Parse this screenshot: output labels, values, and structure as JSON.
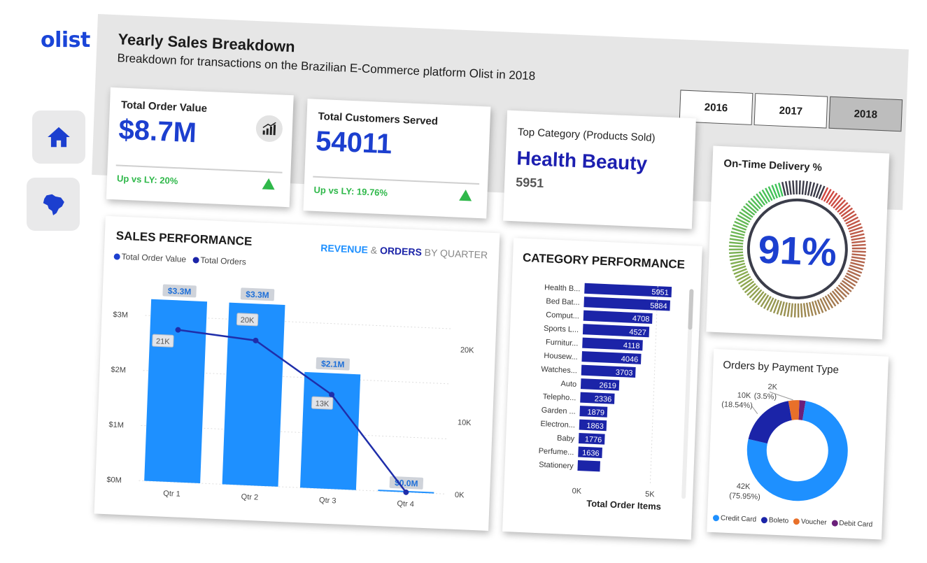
{
  "brand": {
    "logo": "olist"
  },
  "nav": {
    "home_icon": "home-icon",
    "map_icon": "brazil-map-icon"
  },
  "header": {
    "title": "Yearly Sales Breakdown",
    "subtitle": "Breakdown for transactions on the Brazilian E-Commerce platform Olist in 2018"
  },
  "years": {
    "options": [
      "2016",
      "2017",
      "2018"
    ],
    "selected": "2018"
  },
  "kpis": {
    "order_value": {
      "label": "Total Order Value",
      "value": "$8.7M",
      "trend": "Up vs LY: 20%"
    },
    "customers": {
      "label": "Total Customers Served",
      "value": "54011",
      "trend": "Up vs LY: 19.76%"
    },
    "top_category": {
      "label": "Top Category (Products Sold)",
      "value": "Health Beauty",
      "count": "5951"
    },
    "on_time": {
      "label": "On-Time Delivery %",
      "value": "91%"
    }
  },
  "sales_performance": {
    "title": "SALES PERFORMANCE",
    "subtitle_revenue": "REVENUE",
    "subtitle_amp": " & ",
    "subtitle_orders": "ORDERS",
    "subtitle_rest": " BY QUARTER",
    "legend_value": "Total Order Value",
    "legend_orders": "Total Orders",
    "colors": {
      "bar": "#1e90ff",
      "line": "#1f2eaa"
    }
  },
  "category_performance": {
    "title": "CATEGORY PERFORMANCE",
    "xlabel": "Total Order Items",
    "color": "#1b24a8"
  },
  "payment": {
    "title": "Orders by Payment Type",
    "legend": [
      "Credit Card",
      "Boleto",
      "Voucher",
      "Debit Card"
    ],
    "labels": {
      "credit": "42K",
      "credit_pct": "(75.95%)",
      "boleto": "10K",
      "boleto_pct": "(18.54%)",
      "voucher": "(3.5%)",
      "debit": "2K"
    }
  },
  "chart_data": [
    {
      "type": "bar",
      "title": "SALES PERFORMANCE",
      "categories": [
        "Qtr 1",
        "Qtr 2",
        "Qtr 3",
        "Qtr 4"
      ],
      "series": [
        {
          "name": "Total Order Value",
          "type": "bar",
          "values": [
            3.3,
            3.3,
            2.1,
            0.0
          ],
          "labels": [
            "$3.3M",
            "$3.3M",
            "$2.1M",
            "$0.0M"
          ],
          "color": "#1e90ff"
        },
        {
          "name": "Total Orders",
          "type": "line",
          "values": [
            21000,
            20000,
            13000,
            0
          ],
          "labels": [
            "21K",
            "20K",
            "13K",
            ""
          ],
          "color": "#1f2eaa"
        }
      ],
      "y_left": {
        "ticks": [
          "$0M",
          "$1M",
          "$2M",
          "$3M"
        ],
        "range": [
          0,
          3.3
        ]
      },
      "y_right": {
        "ticks": [
          "0K",
          "10K",
          "20K"
        ],
        "range": [
          0,
          27000
        ]
      }
    },
    {
      "type": "bar",
      "orientation": "horizontal",
      "title": "CATEGORY PERFORMANCE",
      "categories": [
        "Health B...",
        "Bed Bat...",
        "Comput...",
        "Sports L...",
        "Furnitur...",
        "Housew...",
        "Watches...",
        "Auto",
        "Telepho...",
        "Garden ...",
        "Electron...",
        "Baby",
        "Perfume...",
        "Stationery"
      ],
      "values": [
        5951,
        5884,
        4708,
        4527,
        4118,
        4046,
        3703,
        2619,
        2336,
        1879,
        1863,
        1776,
        1636,
        null
      ],
      "xlabel": "Total Order Items",
      "x_ticks": [
        "0K",
        "5K"
      ],
      "xlim": [
        0,
        6500
      ]
    },
    {
      "type": "pie",
      "title": "Orders by Payment Type",
      "categories": [
        "Credit Card",
        "Boleto",
        "Voucher",
        "Debit Card"
      ],
      "values": [
        75.95,
        18.54,
        3.5,
        2.01
      ],
      "colors": [
        "#1e90ff",
        "#1b24a8",
        "#e8702a",
        "#6b1f7a"
      ]
    }
  ]
}
